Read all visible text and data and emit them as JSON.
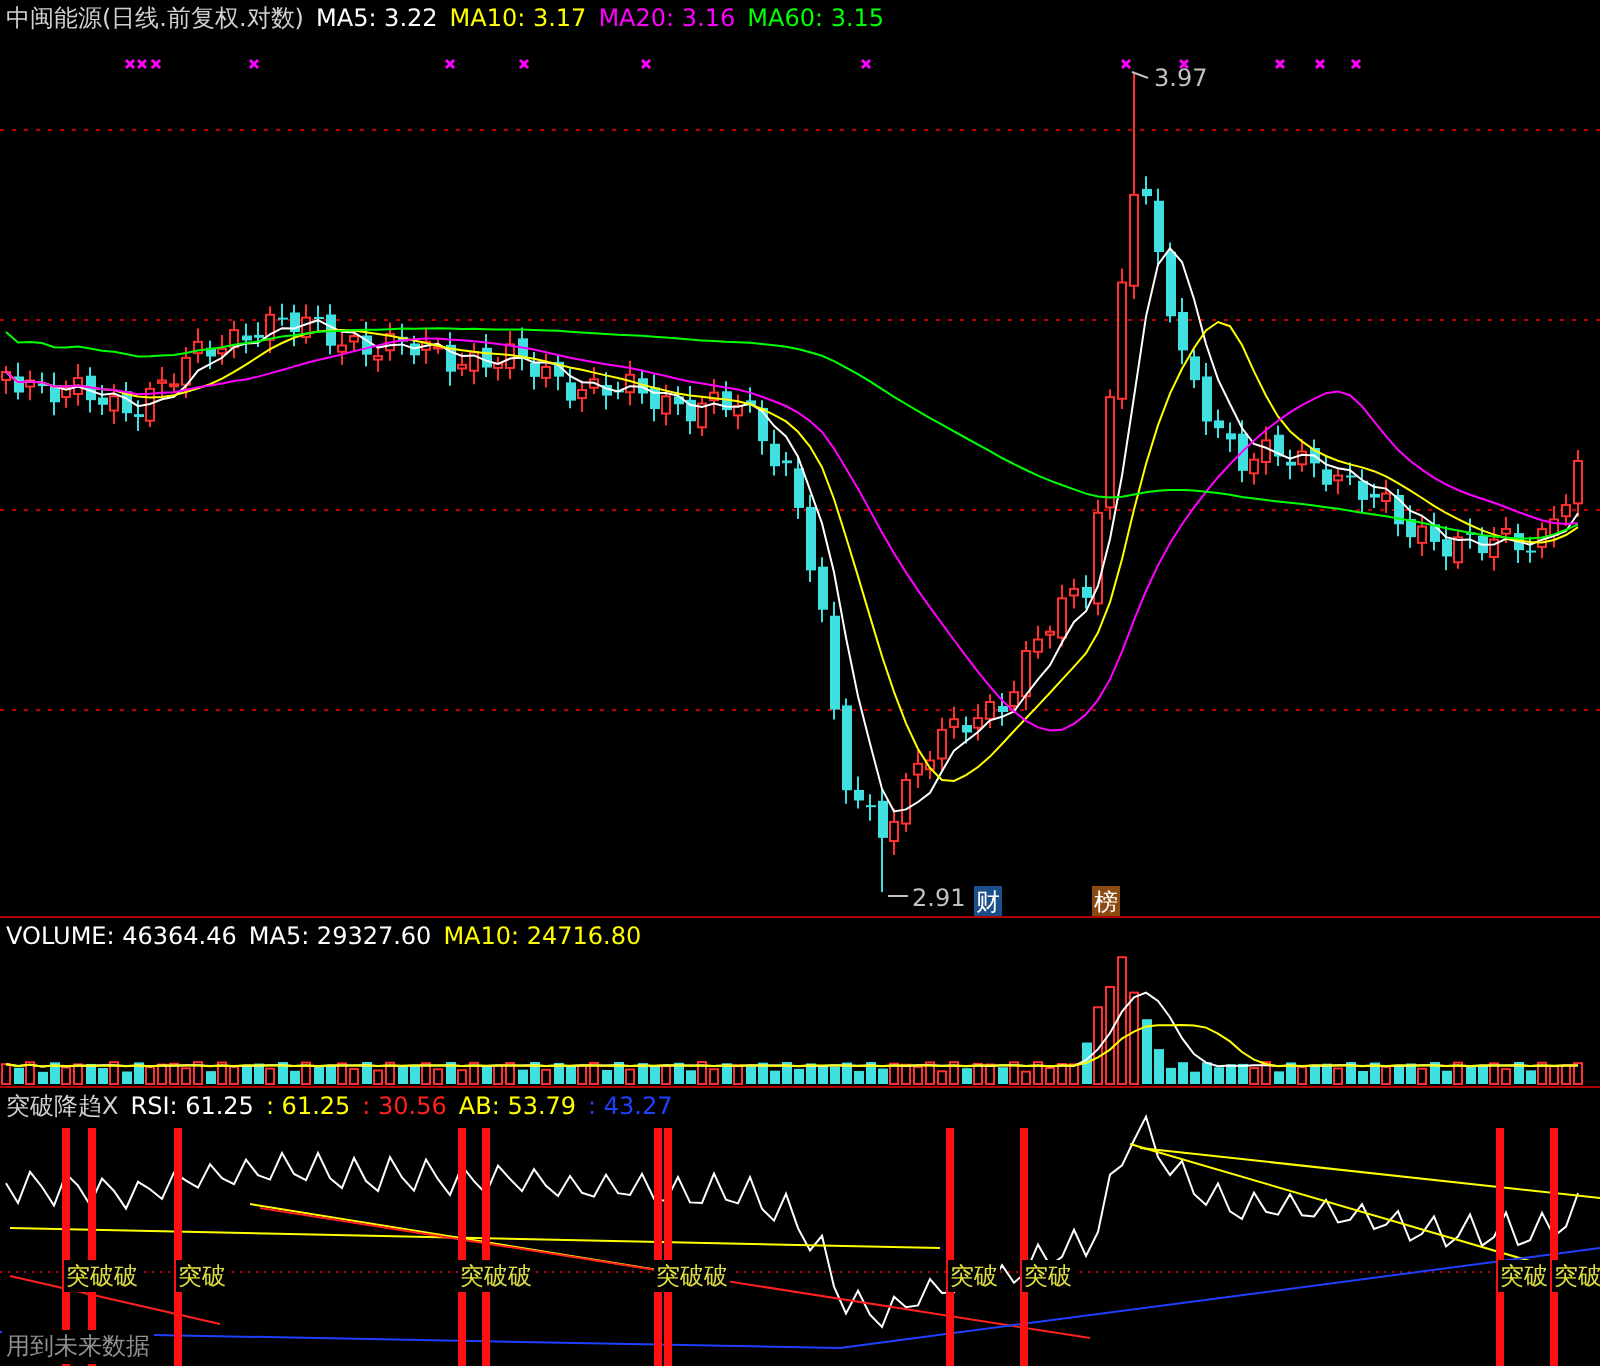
{
  "header": {
    "title": "中闽能源(日线.前复权.对数)",
    "indicators": [
      {
        "label": "MA5: 3.22",
        "color": "#ffffff"
      },
      {
        "label": "MA10: 3.17",
        "color": "#ffff00"
      },
      {
        "label": "MA20: 3.16",
        "color": "#ff00ff"
      },
      {
        "label": "MA60: 3.15",
        "color": "#00ff00"
      }
    ]
  },
  "price_chart": {
    "high_label": "3.97",
    "low_label": "2.91",
    "badges": [
      {
        "text": "财",
        "color": "#1b4f8a"
      },
      {
        "text": "榜",
        "color": "#8b4a10"
      }
    ]
  },
  "volume_panel": {
    "indicators": [
      {
        "label": "VOLUME: 46364.46",
        "color": "#ffffff"
      },
      {
        "label": "MA5: 29327.60",
        "color": "#ffffff"
      },
      {
        "label": "MA10: 24716.80",
        "color": "#ffff00"
      }
    ]
  },
  "indicator_panel": {
    "name": "突破降趋X",
    "indicators": [
      {
        "label": "RSI: 61.25",
        "color": "#ffffff"
      },
      {
        "label": ": 61.25",
        "color": "#ffff00"
      },
      {
        "label": ": 30.56",
        "color": "#ff2020"
      },
      {
        "label": "AB: 53.79",
        "color": "#ffff00"
      },
      {
        "label": ": 43.27",
        "color": "#2040ff"
      }
    ],
    "signals": [
      {
        "label": "突破破"
      },
      {
        "label": "突破"
      },
      {
        "label": "突破破"
      },
      {
        "label": "突破破"
      },
      {
        "label": "突破"
      },
      {
        "label": "突破"
      },
      {
        "label": "突破"
      },
      {
        "label": "突破"
      }
    ],
    "note": "用到未来数据"
  }
}
